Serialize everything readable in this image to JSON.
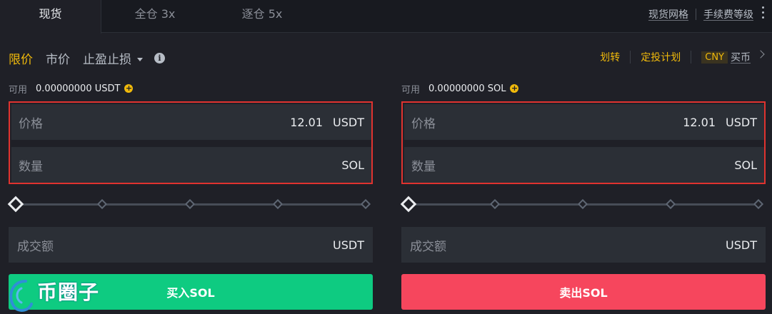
{
  "tabs": [
    {
      "label": "现货",
      "active": true
    },
    {
      "label": "全仓 3x",
      "active": false
    },
    {
      "label": "逐仓 5x",
      "active": false
    }
  ],
  "toplinks": {
    "grid": "现货网格",
    "fee": "手续费等级"
  },
  "order_types": {
    "limit": "限价",
    "market": "市价",
    "stop": "止盈止损"
  },
  "right_actions": {
    "transfer": "划转",
    "dca": "定投计划",
    "currency": "CNY",
    "buy_coin": "买币"
  },
  "buy": {
    "avail_label": "可用",
    "avail_amount": "0.00000000 USDT",
    "price_label": "价格",
    "price_value": "12.01",
    "price_unit": "USDT",
    "qty_label": "数量",
    "qty_unit": "SOL",
    "total_label": "成交额",
    "total_unit": "USDT",
    "button": "买入SOL"
  },
  "sell": {
    "avail_label": "可用",
    "avail_amount": "0.00000000 SOL",
    "price_label": "价格",
    "price_value": "12.01",
    "price_unit": "USDT",
    "qty_label": "数量",
    "qty_unit": "SOL",
    "total_label": "成交额",
    "total_unit": "USDT",
    "button": "卖出SOL"
  },
  "watermark": {
    "text": "币圈子"
  },
  "colors": {
    "accent": "#f0b90b",
    "buy": "#0ecb81",
    "sell": "#f6465d",
    "highlight": "#e0332f"
  }
}
